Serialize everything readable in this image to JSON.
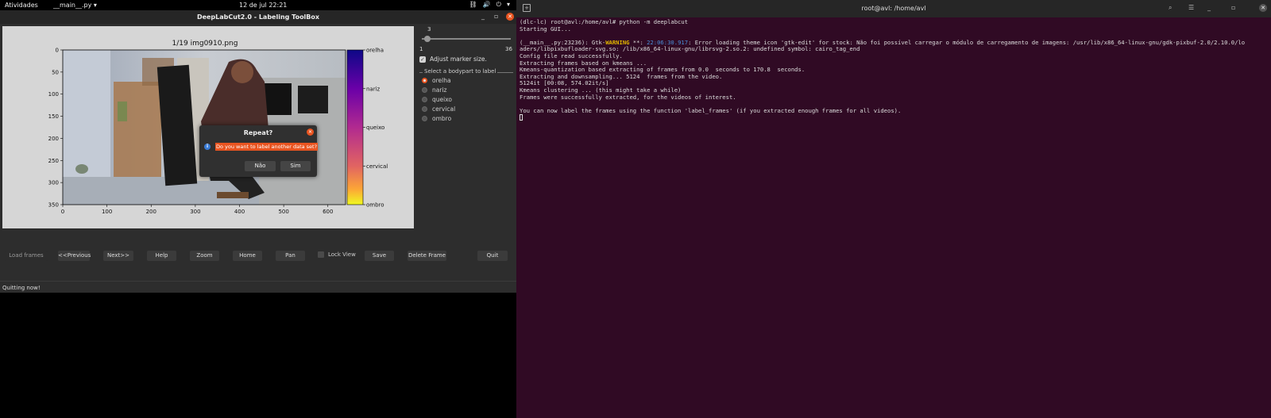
{
  "topbar": {
    "activities": "Atividades",
    "app_menu": "__main__.py",
    "clock": "12 de jul  22:21"
  },
  "dlc_window": {
    "title": "DeepLabCut2.0 - Labeling ToolBox",
    "plot": {
      "title": "1/19 img0910.png",
      "xticks": [
        "0",
        "100",
        "200",
        "300",
        "400",
        "500",
        "600"
      ],
      "yticks": [
        "0",
        "50",
        "100",
        "150",
        "200",
        "250",
        "300",
        "350"
      ],
      "colorbar_labels": [
        "orelha",
        "nariz",
        "queixo",
        "cervical",
        "ombro"
      ]
    },
    "marker_slider": {
      "value": "3",
      "min": "1",
      "max": "36",
      "fraction": 0.06
    },
    "adjust_marker_label": "Adjust marker size.",
    "adjust_marker_checked": true,
    "bodypart_legend": "Select a bodypart to label",
    "bodyparts": [
      "orelha",
      "nariz",
      "queixo",
      "cervical",
      "ombro"
    ],
    "selected_bodypart": "orelha",
    "buttons": {
      "load": "Load frames",
      "previous": "<<Previous",
      "next": "Next>>",
      "help": "Help",
      "zoom": "Zoom",
      "home": "Home",
      "pan": "Pan",
      "lock_view": "Lock View",
      "save": "Save",
      "delete": "Delete Frame",
      "quit": "Quit"
    },
    "status": "Quitting now!"
  },
  "dialog": {
    "title": "Repeat?",
    "message": "Do you want to label another data set?",
    "no": "Não",
    "yes": "Sim"
  },
  "terminal": {
    "title": "root@avl: /home/avl",
    "lines": [
      {
        "text": "(dlc-lc) root@avl:/home/avl# python -m deeplabcut"
      },
      {
        "text": "Starting GUI..."
      },
      {
        "text": ""
      },
      {
        "pre": "(__main__.py:23236): Gtk-",
        "warn": "WARNING",
        "mid": " **: ",
        "ts": "22:06:30.917",
        "post": ": Error loading theme icon 'gtk-edit' for stock: Não foi possível carregar o módulo de carregamento de imagens: /usr/lib/x86_64-linux-gnu/gdk-pixbuf-2.0/2.10.0/lo"
      },
      {
        "text": "aders/libpixbufloader-svg.so: /lib/x86_64-linux-gnu/librsvg-2.so.2: undefined symbol: cairo_tag_end"
      },
      {
        "text": "Config file read successfully."
      },
      {
        "text": "Extracting frames based on kmeans ..."
      },
      {
        "text": "Kmeans-quantization based extracting of frames from 0.0  seconds to 170.8  seconds."
      },
      {
        "text": "Extracting and downsampling... 5124  frames from the video."
      },
      {
        "text": "5124it [00:08, 574.02it/s]"
      },
      {
        "text": "Kmeans clustering ... (this might take a while)"
      },
      {
        "text": "Frames were successfully extracted, for the videos of interest."
      },
      {
        "text": ""
      },
      {
        "text": "You can now label the frames using the function 'label_frames' (if you extracted enough frames for all videos)."
      }
    ]
  }
}
